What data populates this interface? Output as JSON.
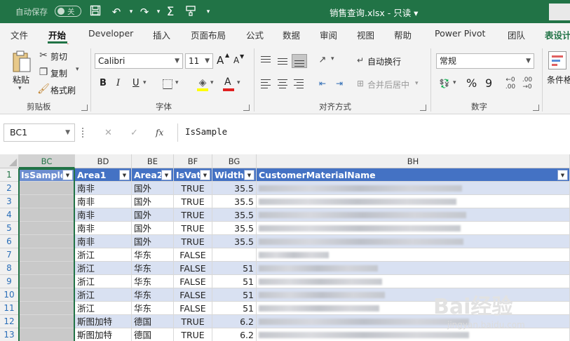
{
  "titlebar": {
    "autosave_label": "自动保存",
    "autosave_state": "关",
    "document_title": "销售查询.xlsx - 只读 ▾",
    "icons": [
      "save-icon",
      "undo-icon",
      "redo-icon",
      "sum-icon",
      "format-painter-icon",
      "chevron-down-icon"
    ]
  },
  "tabs": [
    "文件",
    "开始",
    "Developer",
    "插入",
    "页面布局",
    "公式",
    "数据",
    "审阅",
    "视图",
    "帮助",
    "Power Pivot",
    "团队",
    "表设计"
  ],
  "active_tab": "开始",
  "ribbon": {
    "clipboard": {
      "label": "剪贴板",
      "paste": "粘贴",
      "cut": "剪切",
      "copy": "复制",
      "format_painter": "格式刷"
    },
    "font": {
      "label": "字体",
      "name": "Calibri",
      "size": "11",
      "grow": "A",
      "shrink": "A",
      "bold": "B",
      "italic": "I",
      "underline": "U",
      "font_color": "A"
    },
    "alignment": {
      "label": "对齐方式",
      "wrap": "自动换行",
      "merge": "合并后居中"
    },
    "number": {
      "label": "数字",
      "format": "常规",
      "percent": "%",
      "comma": "9"
    },
    "styles": {
      "conditional": "条件格"
    }
  },
  "formula_bar": {
    "name_box": "BC1",
    "cancel": "✕",
    "confirm": "✓",
    "fx": "fx",
    "formula": "IsSample"
  },
  "sheet": {
    "columns": [
      "BC",
      "BD",
      "BE",
      "BF",
      "BG",
      "BH"
    ],
    "selected_column": "BC",
    "header_row": [
      "IsSample",
      "Area1",
      "Area2",
      "IsVat",
      "Width",
      "CustomerMaterialName"
    ],
    "rows": [
      {
        "num": "2",
        "area1": "南非",
        "area2": "国外",
        "isvat": "TRUE",
        "width": "35.5"
      },
      {
        "num": "3",
        "area1": "南非",
        "area2": "国外",
        "isvat": "TRUE",
        "width": "35.5"
      },
      {
        "num": "4",
        "area1": "南非",
        "area2": "国外",
        "isvat": "TRUE",
        "width": "35.5"
      },
      {
        "num": "5",
        "area1": "南非",
        "area2": "国外",
        "isvat": "TRUE",
        "width": "35.5"
      },
      {
        "num": "6",
        "area1": "南非",
        "area2": "国外",
        "isvat": "TRUE",
        "width": "35.5"
      },
      {
        "num": "7",
        "area1": "浙江",
        "area2": "华东",
        "isvat": "FALSE",
        "width": ""
      },
      {
        "num": "8",
        "area1": "浙江",
        "area2": "华东",
        "isvat": "FALSE",
        "width": "51"
      },
      {
        "num": "9",
        "area1": "浙江",
        "area2": "华东",
        "isvat": "FALSE",
        "width": "51"
      },
      {
        "num": "10",
        "area1": "浙江",
        "area2": "华东",
        "isvat": "FALSE",
        "width": "51"
      },
      {
        "num": "11",
        "area1": "浙江",
        "area2": "华东",
        "isvat": "FALSE",
        "width": "51"
      },
      {
        "num": "12",
        "area1": "斯图加特",
        "area2": "德国",
        "isvat": "TRUE",
        "width": "6.2"
      },
      {
        "num": "13",
        "area1": "斯图加特",
        "area2": "德国",
        "isvat": "TRUE",
        "width": "6.2"
      }
    ]
  },
  "watermark": {
    "logo": "Bai经验",
    "site": "jingyan.baidu.com"
  },
  "colors": {
    "excel_green": "#217346",
    "table_header": "#4472c4",
    "band": "#d9e1f2",
    "arrow": "#e02020"
  }
}
